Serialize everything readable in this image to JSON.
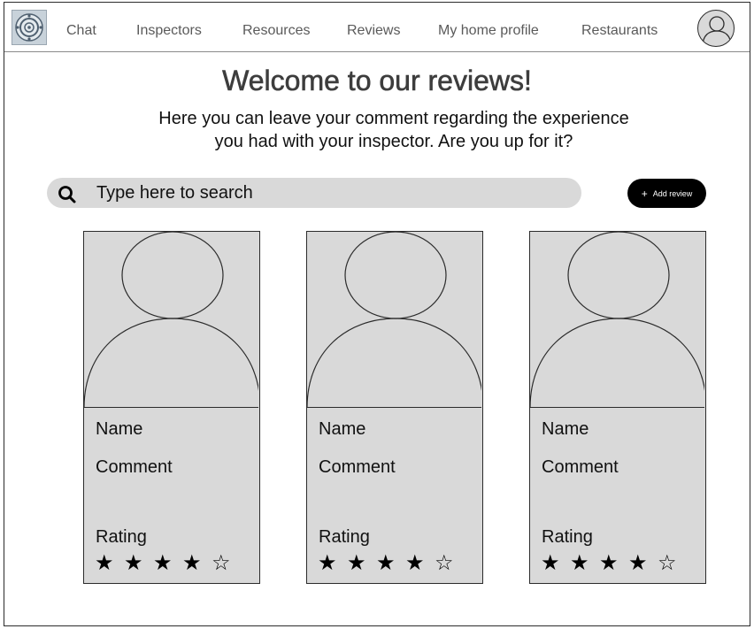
{
  "nav": {
    "logo_icon": "compass-logo-icon",
    "items": [
      "Chat",
      "Inspectors",
      "Resources",
      "Reviews",
      "My home profile",
      "Restaurants"
    ],
    "avatar_icon": "user-avatar-icon"
  },
  "header": {
    "title": "Welcome to our reviews!",
    "subtitle_line1": "Here you can leave your comment regarding the experience",
    "subtitle_line2": "you had with your inspector. Are you up for it?"
  },
  "search": {
    "placeholder": "Type here to search",
    "icon": "search-icon"
  },
  "add_review": {
    "plus": "+",
    "label": "Add review"
  },
  "cards": [
    {
      "name": "Name",
      "comment": "Comment",
      "rating_label": "Rating",
      "rating": 4,
      "max_rating": 5
    },
    {
      "name": "Name",
      "comment": "Comment",
      "rating_label": "Rating",
      "rating": 4,
      "max_rating": 5
    },
    {
      "name": "Name",
      "comment": "Comment",
      "rating_label": "Rating",
      "rating": 4,
      "max_rating": 5
    }
  ],
  "colors": {
    "placeholder_gray": "#d9d9d9",
    "button_black": "#000000",
    "nav_text": "#5a5a5a"
  }
}
